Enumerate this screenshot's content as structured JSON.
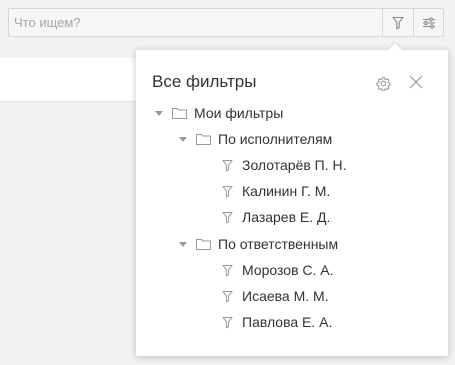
{
  "search": {
    "placeholder": "Что ищем?",
    "filter_icon": "filter-icon",
    "settings_icon": "sliders-icon"
  },
  "popup": {
    "title": "Все фильтры",
    "gear_icon": "gear-icon",
    "close_icon": "close-icon",
    "tree": {
      "root": {
        "label": "Мои фильтры",
        "icon": "folder-icon",
        "expanded": true
      },
      "groups": [
        {
          "label": "По исполнителям",
          "icon": "folder-icon",
          "expanded": true,
          "items": [
            "Золотарёв П. Н.",
            "Калинин Г. М.",
            "Лазарев Е. Д."
          ]
        },
        {
          "label": "По ответственным",
          "icon": "folder-icon",
          "expanded": true,
          "items": [
            "Морозов С. А.",
            "Исаева М. М.",
            "Павлова Е. А."
          ]
        }
      ]
    }
  },
  "colors": {
    "background": "#f2f2f2",
    "icon": "#9a9a9a",
    "text": "#333333"
  }
}
